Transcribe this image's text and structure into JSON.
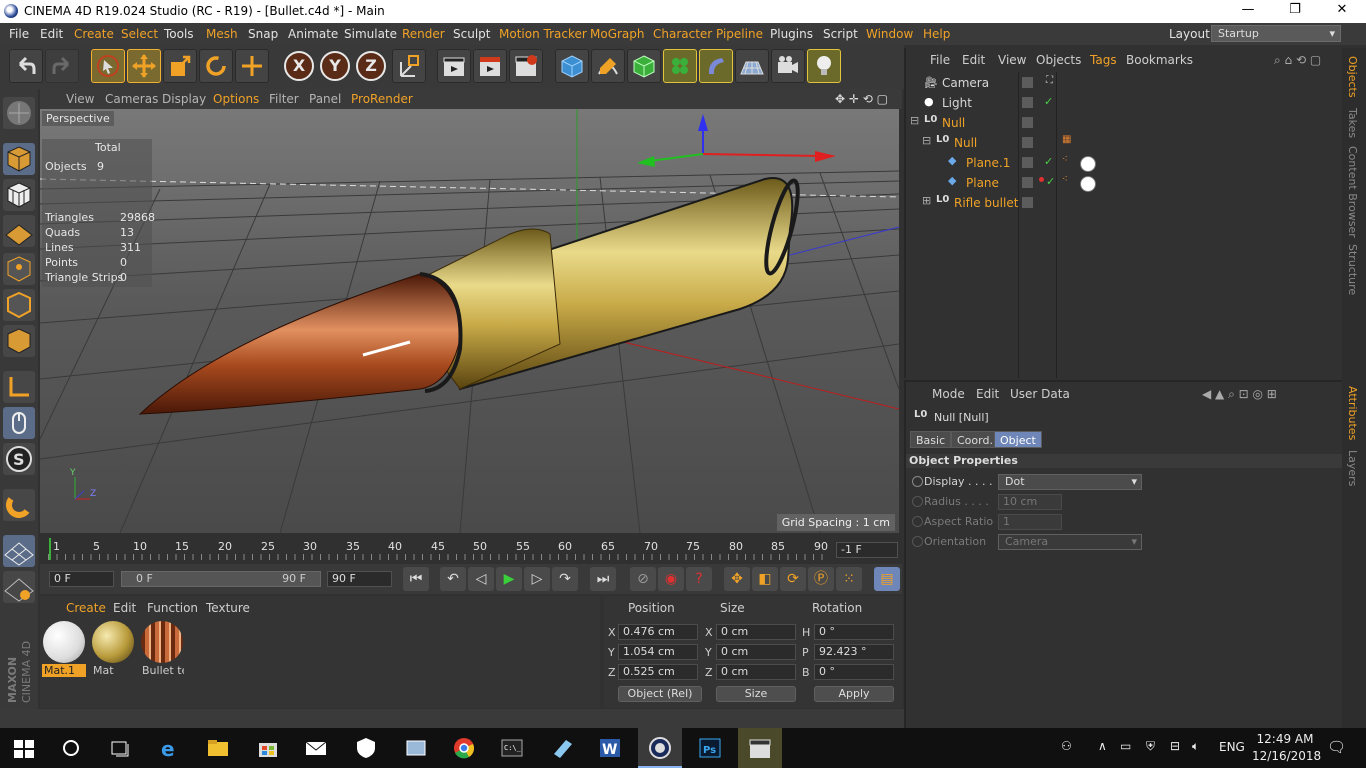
{
  "window": {
    "title": "CINEMA 4D R19.024 Studio (RC - R19) - [Bullet.c4d *] - Main",
    "minimize": "—",
    "maximize": "❐",
    "close": "✕"
  },
  "menubar": {
    "items": [
      "File",
      "Edit",
      "Create",
      "Select",
      "Tools",
      "Mesh",
      "Snap",
      "Animate",
      "Simulate",
      "Render",
      "Sculpt",
      "Motion Tracker",
      "MoGraph",
      "Character",
      "Pipeline",
      "Plugins",
      "Script",
      "Window",
      "Help"
    ],
    "layout_label": "Layout:",
    "layout_value": "Startup"
  },
  "toolbar": {
    "x_label": "X",
    "y_label": "Y",
    "z_label": "Z"
  },
  "viewport": {
    "menu": [
      "View",
      "Cameras",
      "Display",
      "Options",
      "Filter",
      "Panel",
      "ProRender"
    ],
    "label": "Perspective",
    "stats": {
      "total_header": "Total",
      "objects_label": "Objects",
      "objects_value": "9",
      "triangles_label": "Triangles",
      "triangles_value": "29868",
      "quads_label": "Quads",
      "quads_value": "13",
      "lines_label": "Lines",
      "lines_value": "311",
      "points_label": "Points",
      "points_value": "0",
      "strips_label": "Triangle Strips",
      "strips_value": "0"
    },
    "grid_spacing": "Grid Spacing : 1 cm",
    "axis_y": "Y",
    "axis_z": "Z",
    "axis_x": "X"
  },
  "timeline": {
    "ticks": [
      "1",
      "5",
      "10",
      "15",
      "20",
      "25",
      "30",
      "35",
      "40",
      "45",
      "50",
      "55",
      "60",
      "65",
      "70",
      "75",
      "80",
      "85",
      "90"
    ],
    "current_frame_field": "-1 F",
    "start_field": "0 F",
    "range_start": "0 F",
    "range_end": "90 F",
    "end_field": "90 F"
  },
  "material_manager": {
    "menu": [
      "Create",
      "Edit",
      "Function",
      "Texture"
    ],
    "materials": [
      {
        "name": "Mat.1",
        "color": "#ffffff"
      },
      {
        "name": "Mat",
        "color": "#b89a3a"
      },
      {
        "name": "Bullet te",
        "color": "#8a3e1e"
      }
    ]
  },
  "coordinates": {
    "headers": [
      "Position",
      "Size",
      "Rotation"
    ],
    "rows": [
      {
        "pos_label": "X",
        "pos": "0.476 cm",
        "size_label": "X",
        "size": "0 cm",
        "rot_label": "H",
        "rot": "0 °"
      },
      {
        "pos_label": "Y",
        "pos": "1.054 cm",
        "size_label": "Y",
        "size": "0 cm",
        "rot_label": "P",
        "rot": "92.423 °"
      },
      {
        "pos_label": "Z",
        "pos": "0.525 cm",
        "size_label": "Z",
        "size": "0 cm",
        "rot_label": "B",
        "rot": "0 °"
      }
    ],
    "mode": "Object (Rel)",
    "size_mode": "Size",
    "apply": "Apply"
  },
  "object_manager": {
    "menu": [
      "File",
      "Edit",
      "View",
      "Objects",
      "Tags",
      "Bookmarks"
    ],
    "objects": [
      {
        "name": "Camera",
        "orange": false,
        "indent": 1
      },
      {
        "name": "Light",
        "orange": false,
        "indent": 1
      },
      {
        "name": "Null",
        "orange": true,
        "indent": 0
      },
      {
        "name": "Null",
        "orange": true,
        "indent": 1
      },
      {
        "name": "Plane.1",
        "orange": true,
        "indent": 2
      },
      {
        "name": "Plane",
        "orange": true,
        "indent": 2
      },
      {
        "name": "Rifle bullet",
        "orange": true,
        "indent": 1
      }
    ]
  },
  "attribute_manager": {
    "menu": [
      "Mode",
      "Edit",
      "User Data"
    ],
    "object_title": "Null [Null]",
    "tabs": [
      "Basic",
      "Coord.",
      "Object"
    ],
    "section": "Object Properties",
    "props": [
      {
        "label": "Display . . . .",
        "value": "Dot",
        "enabled": true
      },
      {
        "label": "Radius . . . .",
        "value": "10 cm",
        "enabled": false
      },
      {
        "label": "Aspect Ratio",
        "value": "1",
        "enabled": false
      },
      {
        "label": "Orientation",
        "value": "Camera",
        "enabled": false
      }
    ]
  },
  "side_tabs": {
    "top": [
      "Objects",
      "Takes",
      "Content Browser",
      "Structure"
    ],
    "bottom": [
      "Attributes",
      "Layers"
    ]
  },
  "branding": {
    "maxon": "MAXON",
    "c4d": "CINEMA 4D"
  },
  "taskbar": {
    "time": "12:49 AM",
    "date": "12/16/2018",
    "lang": "ENG"
  },
  "colors": {
    "accent": "#f0a227",
    "panel_bg": "#313131",
    "selection_blue": "#6f86b8"
  }
}
